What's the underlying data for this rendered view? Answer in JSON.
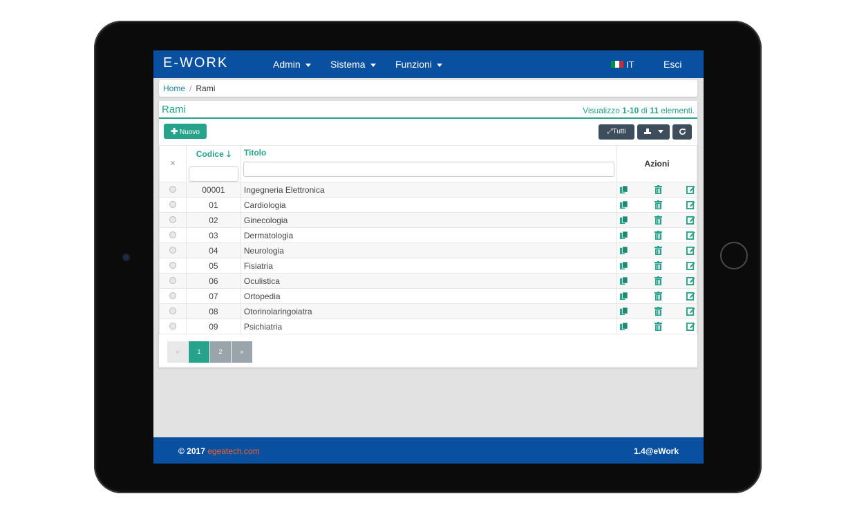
{
  "navbar": {
    "brand": "E-WORK",
    "menus": [
      {
        "label": "Admin"
      },
      {
        "label": "Sistema"
      },
      {
        "label": "Funzioni"
      }
    ],
    "language": "IT",
    "logout": "Esci",
    "flag_colors": [
      "#009246",
      "#ffffff",
      "#ce2b37"
    ]
  },
  "breadcrumb": {
    "home": "Home",
    "separator": "/",
    "current": "Rami"
  },
  "panel": {
    "title": "Rami",
    "summary_prefix": "Visualizzo ",
    "summary_range": "1-10",
    "summary_mid": " di ",
    "summary_total": "11",
    "summary_suffix": " elementi."
  },
  "toolbar": {
    "new_label": "Nuovo",
    "all_label": "Tutti",
    "export_icon": "export-icon",
    "refresh_icon": "refresh-icon"
  },
  "table": {
    "clear_symbol": "×",
    "columns": {
      "code": "Codice",
      "title": "Titolo",
      "actions": "Azioni"
    },
    "rows": [
      {
        "code": "00001",
        "title": "Ingegneria Elettronica"
      },
      {
        "code": "01",
        "title": "Cardiologia"
      },
      {
        "code": "02",
        "title": "Ginecologia"
      },
      {
        "code": "03",
        "title": "Dermatologia"
      },
      {
        "code": "04",
        "title": "Neurologia"
      },
      {
        "code": "05",
        "title": "Fisiatria"
      },
      {
        "code": "06",
        "title": "Oculistica"
      },
      {
        "code": "07",
        "title": "Ortopedia"
      },
      {
        "code": "08",
        "title": "Otorinolaringoiatra"
      },
      {
        "code": "09",
        "title": "Psichiatria"
      }
    ]
  },
  "pagination": {
    "prev": "«",
    "pages": [
      "1",
      "2"
    ],
    "active_page": "1",
    "next": "»"
  },
  "footer": {
    "copyright": "© 2017 ",
    "link": "egeatech.com",
    "version": "1.4@eWork"
  },
  "colors": {
    "primary_blue": "#0a50a0",
    "accent_green": "#26a38a",
    "dark_button": "#3d4d5c",
    "link_orange": "#e8622c"
  }
}
